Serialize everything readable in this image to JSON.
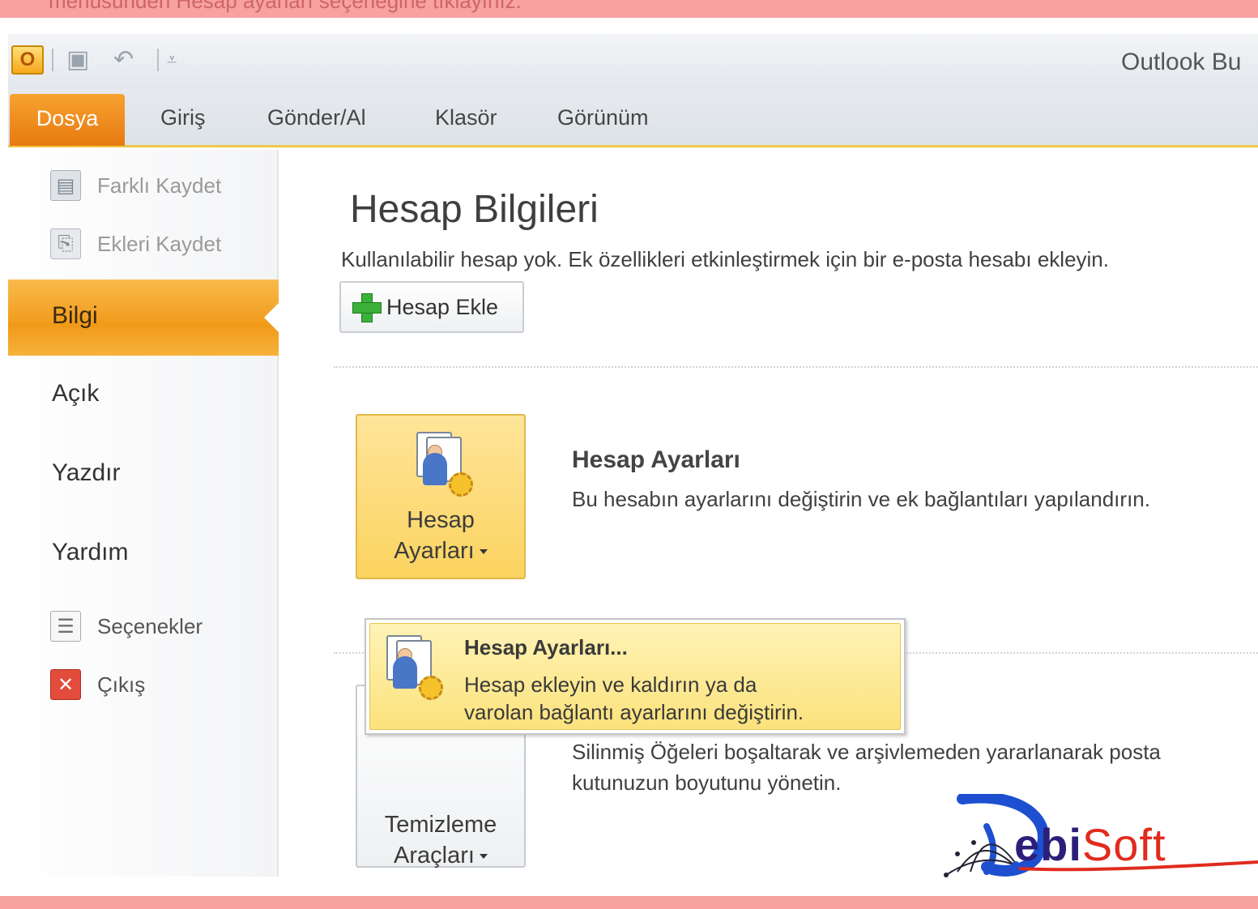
{
  "top_caption": "menüsünden Hesap ayarları seçeneğine tıklayınız.",
  "window": {
    "title": "Outlook Bu",
    "quick_access": [
      {
        "icon": "outlook-icon",
        "label": "O"
      },
      {
        "icon": "save-icon"
      },
      {
        "icon": "undo-icon"
      },
      {
        "icon": "customize-icon"
      }
    ]
  },
  "ribbon": {
    "tabs": [
      {
        "label": "Dosya",
        "active": true
      },
      {
        "label": "Giriş"
      },
      {
        "label": "Gönder/Al"
      },
      {
        "label": "Klasör"
      },
      {
        "label": "Görünüm"
      }
    ]
  },
  "backstage": {
    "commands": [
      {
        "label": "Farklı Kaydet",
        "icon": "save-as-icon",
        "enabled": false
      },
      {
        "label": "Ekleri Kaydet",
        "icon": "save-attachments-icon",
        "enabled": false
      }
    ],
    "nav": [
      {
        "label": "Bilgi",
        "selected": true
      },
      {
        "label": "Açık"
      },
      {
        "label": "Yazdır"
      },
      {
        "label": "Yardım"
      }
    ],
    "bottom_commands": [
      {
        "label": "Seçenekler",
        "icon": "options-icon"
      },
      {
        "label": "Çıkış",
        "icon": "exit-icon"
      }
    ]
  },
  "info": {
    "heading": "Hesap Bilgileri",
    "subtitle": "Kullanılabilir hesap yok. Ek özellikleri etkinleştirmek için bir e-posta hesabı ekleyin.",
    "add_account_button": "Hesap Ekle",
    "account_settings": {
      "button_line1": "Hesap",
      "button_line2": "Ayarları",
      "title": "Hesap Ayarları",
      "description": "Bu hesabın ayarlarını değiştirin ve ek bağlantıları yapılandırın."
    },
    "cleanup": {
      "button_line1": "Temizleme",
      "button_line2": "Araçları",
      "description_line1": "Silinmiş Öğeleri boşaltarak ve arşivlemeden yararlanarak posta",
      "description_line2": "kutunuzun boyutunu yönetin."
    },
    "dropdown": {
      "title": "Hesap Ayarları...",
      "description_line1": "Hesap ekleyin ve kaldırın ya da",
      "description_line2": "varolan bağlantı ayarlarını değiştirin."
    }
  },
  "logo": {
    "text_main": "ebi",
    "text_accent": "Soft"
  }
}
